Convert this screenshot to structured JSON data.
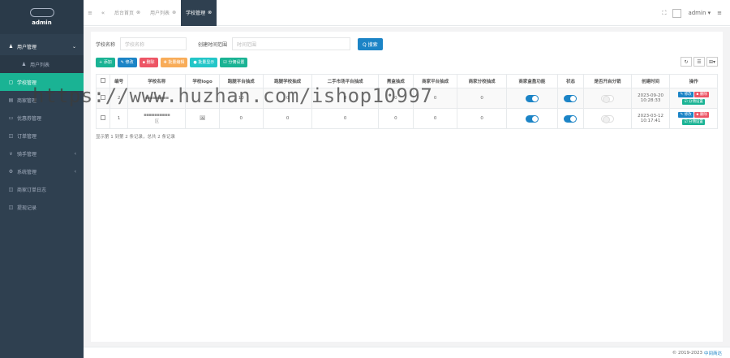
{
  "sidebar": {
    "brand": "admin",
    "items": [
      {
        "icon": "user-icon",
        "glyph": "♟",
        "label": "用户管理",
        "arrow": "⌄"
      },
      {
        "icon": "user-icon",
        "glyph": "♟",
        "label": "用户列表"
      },
      {
        "icon": "school-icon",
        "glyph": "▢",
        "label": "学校管理"
      },
      {
        "icon": "shop-icon",
        "glyph": "▤",
        "label": "商家管理"
      },
      {
        "icon": "card-icon",
        "glyph": "▭",
        "label": "优惠券管理"
      },
      {
        "icon": "order-icon",
        "glyph": "◫",
        "label": "订单管理"
      },
      {
        "icon": "rider-icon",
        "glyph": "∨",
        "label": "骑手管理",
        "arrow": "‹"
      },
      {
        "icon": "gear-icon",
        "glyph": "⚙",
        "label": "系统管理",
        "arrow": "‹"
      },
      {
        "icon": "list-icon",
        "glyph": "◫",
        "label": "商家订单日志"
      },
      {
        "icon": "list-icon",
        "glyph": "◫",
        "label": "提现记录"
      }
    ]
  },
  "topbar": {
    "menu_glyph": "≡",
    "back_glyph": "«",
    "tabs": [
      {
        "label": "后台首页",
        "close": "⊗"
      },
      {
        "label": "用户列表",
        "close": "⊗"
      },
      {
        "label": "学校管理",
        "close": "⊗"
      }
    ],
    "fullscreen_glyph": "⛶",
    "user": "admin ▾",
    "hamburger_glyph": "≡"
  },
  "search": {
    "school_name_label": "学校名称",
    "school_name_placeholder": "学校名称",
    "created_label": "创建时间范围",
    "created_placeholder": "时间范围",
    "search_button": "Q 搜索"
  },
  "toolbar": {
    "add": "+ 添加",
    "edit": "✎ 修改",
    "delete": "▪ 删除",
    "import": "✚ 批量编辑",
    "show": "● 批量显示",
    "commission": "☑ 分佣设置",
    "tool_refresh": "↻",
    "tool_columns": "☰",
    "tool_export": "⊞▾"
  },
  "table": {
    "headers": [
      "",
      "编号",
      "学校名称",
      "学校logo",
      "跑腿平台抽成",
      "跑腿学校抽成",
      "二手市场平台抽成",
      "黑盒抽成",
      "商家平台抽成",
      "商家分校抽成",
      "商家盒盈功能",
      "状态",
      "是否开启分销",
      "创建时间",
      "操作"
    ],
    "rows": [
      {
        "id": "2",
        "name": "▪▪▪▪▪▪▪▪▪",
        "name2": "",
        "logo": "",
        "c1": "10",
        "c2": "0",
        "c3": "0",
        "c4": "0",
        "c5": "0",
        "c6": "0",
        "t1": "on",
        "t2": "on",
        "t3": "off",
        "time1": "2023-09-20",
        "time2": "10:28:33",
        "op_edit": "✎ 修改",
        "op_delete": "▪ 删除",
        "op_comm": "☑ 分佣设置"
      },
      {
        "id": "1",
        "name": "▪▪▪▪▪▪▪▪▪▪",
        "name2": "区",
        "logo": "🖼",
        "c1": "0",
        "c2": "0",
        "c3": "0",
        "c4": "0",
        "c5": "0",
        "c6": "0",
        "t1": "on",
        "t2": "on",
        "t3": "off",
        "time1": "2023-03-12",
        "time2": "10:17:41",
        "op_edit": "✎ 修改",
        "op_delete": "▪ 删除",
        "op_comm": "☑ 分佣设置"
      }
    ],
    "pagination": "显示第 1 到第 2 条记录，总共 2 条记录"
  },
  "footer": {
    "copyright": "© 2019-2023",
    "link": "中间商达"
  },
  "watermark": "https://www.huzhan.com/ishop10997"
}
